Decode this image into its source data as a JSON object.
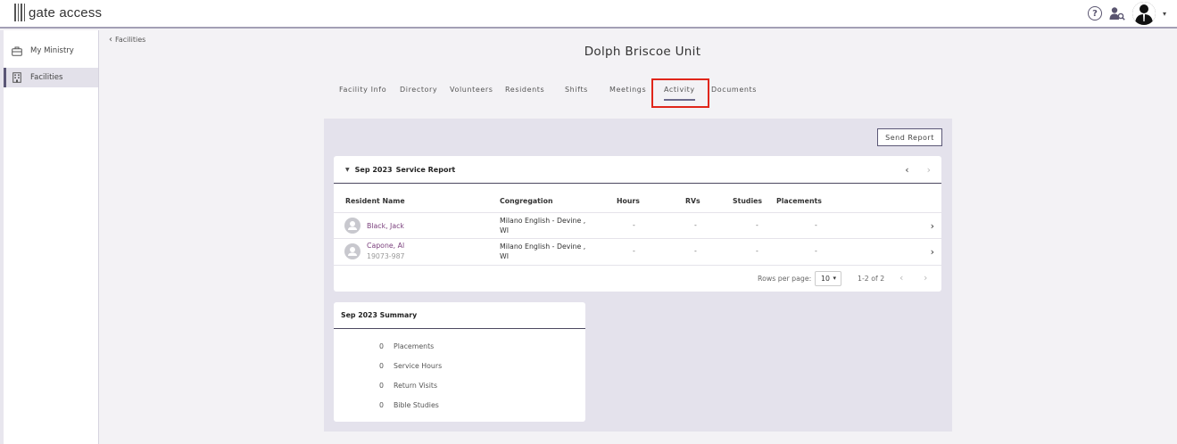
{
  "header": {
    "logo_text": "gate access",
    "help_glyph": "?",
    "icons": [
      "help-circle-icon",
      "people-search-icon",
      "user-avatar-icon",
      "caret-down-icon"
    ]
  },
  "sidebar": {
    "items": [
      {
        "label": "My Ministry",
        "icon": "briefcase-icon",
        "active": false
      },
      {
        "label": "Facilities",
        "icon": "building-icon",
        "active": true
      }
    ]
  },
  "breadcrumb": {
    "back_label": "Facilities"
  },
  "page": {
    "title": "Dolph Briscoe Unit"
  },
  "tabs": [
    "Facility Info",
    "Directory",
    "Volunteers",
    "Residents",
    "Shifts",
    "Meetings",
    "Activity",
    "Documents"
  ],
  "active_tab": "Activity",
  "colors": {
    "accent": "#5b5776",
    "highlight": "#e0261a",
    "link": "#7a3f7c",
    "panel_bg": "#e4e2ec"
  },
  "report": {
    "send_label": "Send Report",
    "month": "Sep 2023",
    "title_suffix": "Service Report",
    "columns": [
      "Resident Name",
      "Congregation",
      "Hours",
      "RVs",
      "Studies",
      "Placements"
    ],
    "rows": [
      {
        "name": "Black, Jack",
        "id": "",
        "congregation": "Milano English - Devine , WI",
        "hours": "-",
        "rvs": "-",
        "studies": "-",
        "placements": "-"
      },
      {
        "name": "Capone, Al",
        "id": "19073-987",
        "congregation": "Milano English - Devine , WI",
        "hours": "-",
        "rvs": "-",
        "studies": "-",
        "placements": "-"
      }
    ],
    "pagination": {
      "rows_per_page_label": "Rows per page:",
      "rows_per_page": "10",
      "range": "1-2 of 2"
    }
  },
  "summary": {
    "title": "Sep 2023 Summary",
    "items": [
      {
        "value": "0",
        "label": "Placements"
      },
      {
        "value": "0",
        "label": "Service Hours"
      },
      {
        "value": "0",
        "label": "Return Visits"
      },
      {
        "value": "0",
        "label": "Bible Studies"
      }
    ]
  }
}
